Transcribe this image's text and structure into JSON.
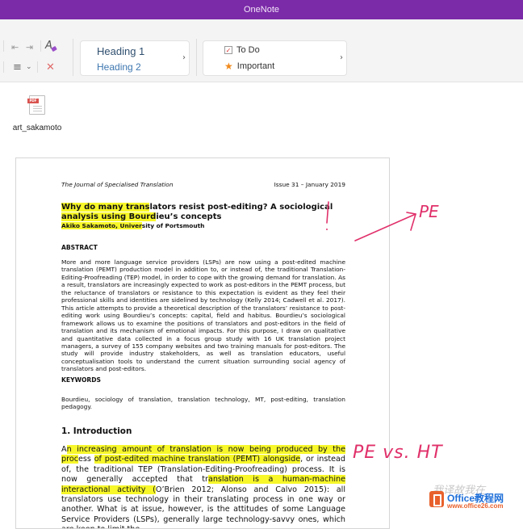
{
  "app": {
    "title": "OneNote"
  },
  "ribbon": {
    "styles": {
      "heading1": "Heading 1",
      "heading2": "Heading 2",
      "more": "›"
    },
    "tags": {
      "todo": "To Do",
      "important": "Important",
      "more": "›",
      "todo_check": "✓",
      "star": "★"
    },
    "icons": {
      "outdent": "⇤",
      "indent": "⇥",
      "clear_format": "A",
      "align": "≡",
      "align_dropdown": "⌄",
      "delete": "✕"
    }
  },
  "attachment": {
    "badge": "PDF",
    "filename": "art_sakamoto"
  },
  "document": {
    "journal": "The Journal of Specialised Translation",
    "issue": "Issue 31 – January 2019",
    "title_hl": "Why do many trans",
    "title_rest": "lators resist post-editing? A sociological",
    "title_line2_hl": "analysis using Bourd",
    "title_line2_rest": "ieu’s concepts",
    "author_hl": "Akiko Sakamoto, Univer",
    "author_rest": "sity of Portsmouth",
    "abstract_heading": "ABSTRACT",
    "abstract": "More and more language service providers (LSPs) are now using a post-edited machine translation (PEMT) production model in addition to, or instead of, the traditional Translation-Editing-Proofreading (TEP) model, in order to cope with the growing demand for translation. As a result, translators are increasingly expected to work as post-editors in the PEMT process, but the reluctance of translators or resistance to this expectation is evident as they feel their professional skills and identities are sidelined by technology (Kelly 2014; Cadwell et al. 2017). This article attempts to provide a theoretical description of the translators’ resistance to post-editing work using Bourdieu’s concepts: capital, field and habitus. Bourdieu’s sociological framework allows us to examine the positions of translators and post-editors in the field of translation and its mechanism of emotional impacts. For this purpose, I draw on qualitative and quantitative data collected in a focus group study with 16 UK translation project managers, a survey of 155 company websites and two training manuals for post-editors. The study will provide industry stakeholders, as well as translation educators, useful conceptualisation tools to understand the current situation surrounding social agency of translators and post-editors.",
    "keywords_heading": "KEYWORDS",
    "keywords": "Bourdieu, sociology of translation, translation technology, MT, post-editing, translation pedagogy.",
    "intro_heading": "1. Introduction",
    "intro": {
      "p1": "A",
      "h1": "n increasing amount of translation is now being produced by the proc",
      "p2": "ess ",
      "h2": "of post-edited machine translation (PEMT) alongside",
      "p3": ", or instead of, the traditional TEP (Translation-Editing-Proofreading) process. It is now generally accepted that tr",
      "h3": "anslation is a human-machine interactional activity (",
      "p4": "O’Brien 2012; Alonso and Calvo 2015): all translators use technology in their translating process in one way or another. What is at issue, however, is the attitudes of some Language Service Providers (LSPs), generally large technology-savvy ones, which are keen to limit the"
    }
  },
  "annotations": {
    "exclaim": "!",
    "pe": "PE",
    "pe_vs_ht": "PE vs. HT"
  },
  "watermark": {
    "cn": "我译故我在",
    "brand": "Office教程网",
    "url": "www.office26.com"
  },
  "colors": {
    "titlebar": "#7b2aa8",
    "highlight": "#f7f72a",
    "ink": "#e0306a",
    "star": "#f08a1c"
  }
}
